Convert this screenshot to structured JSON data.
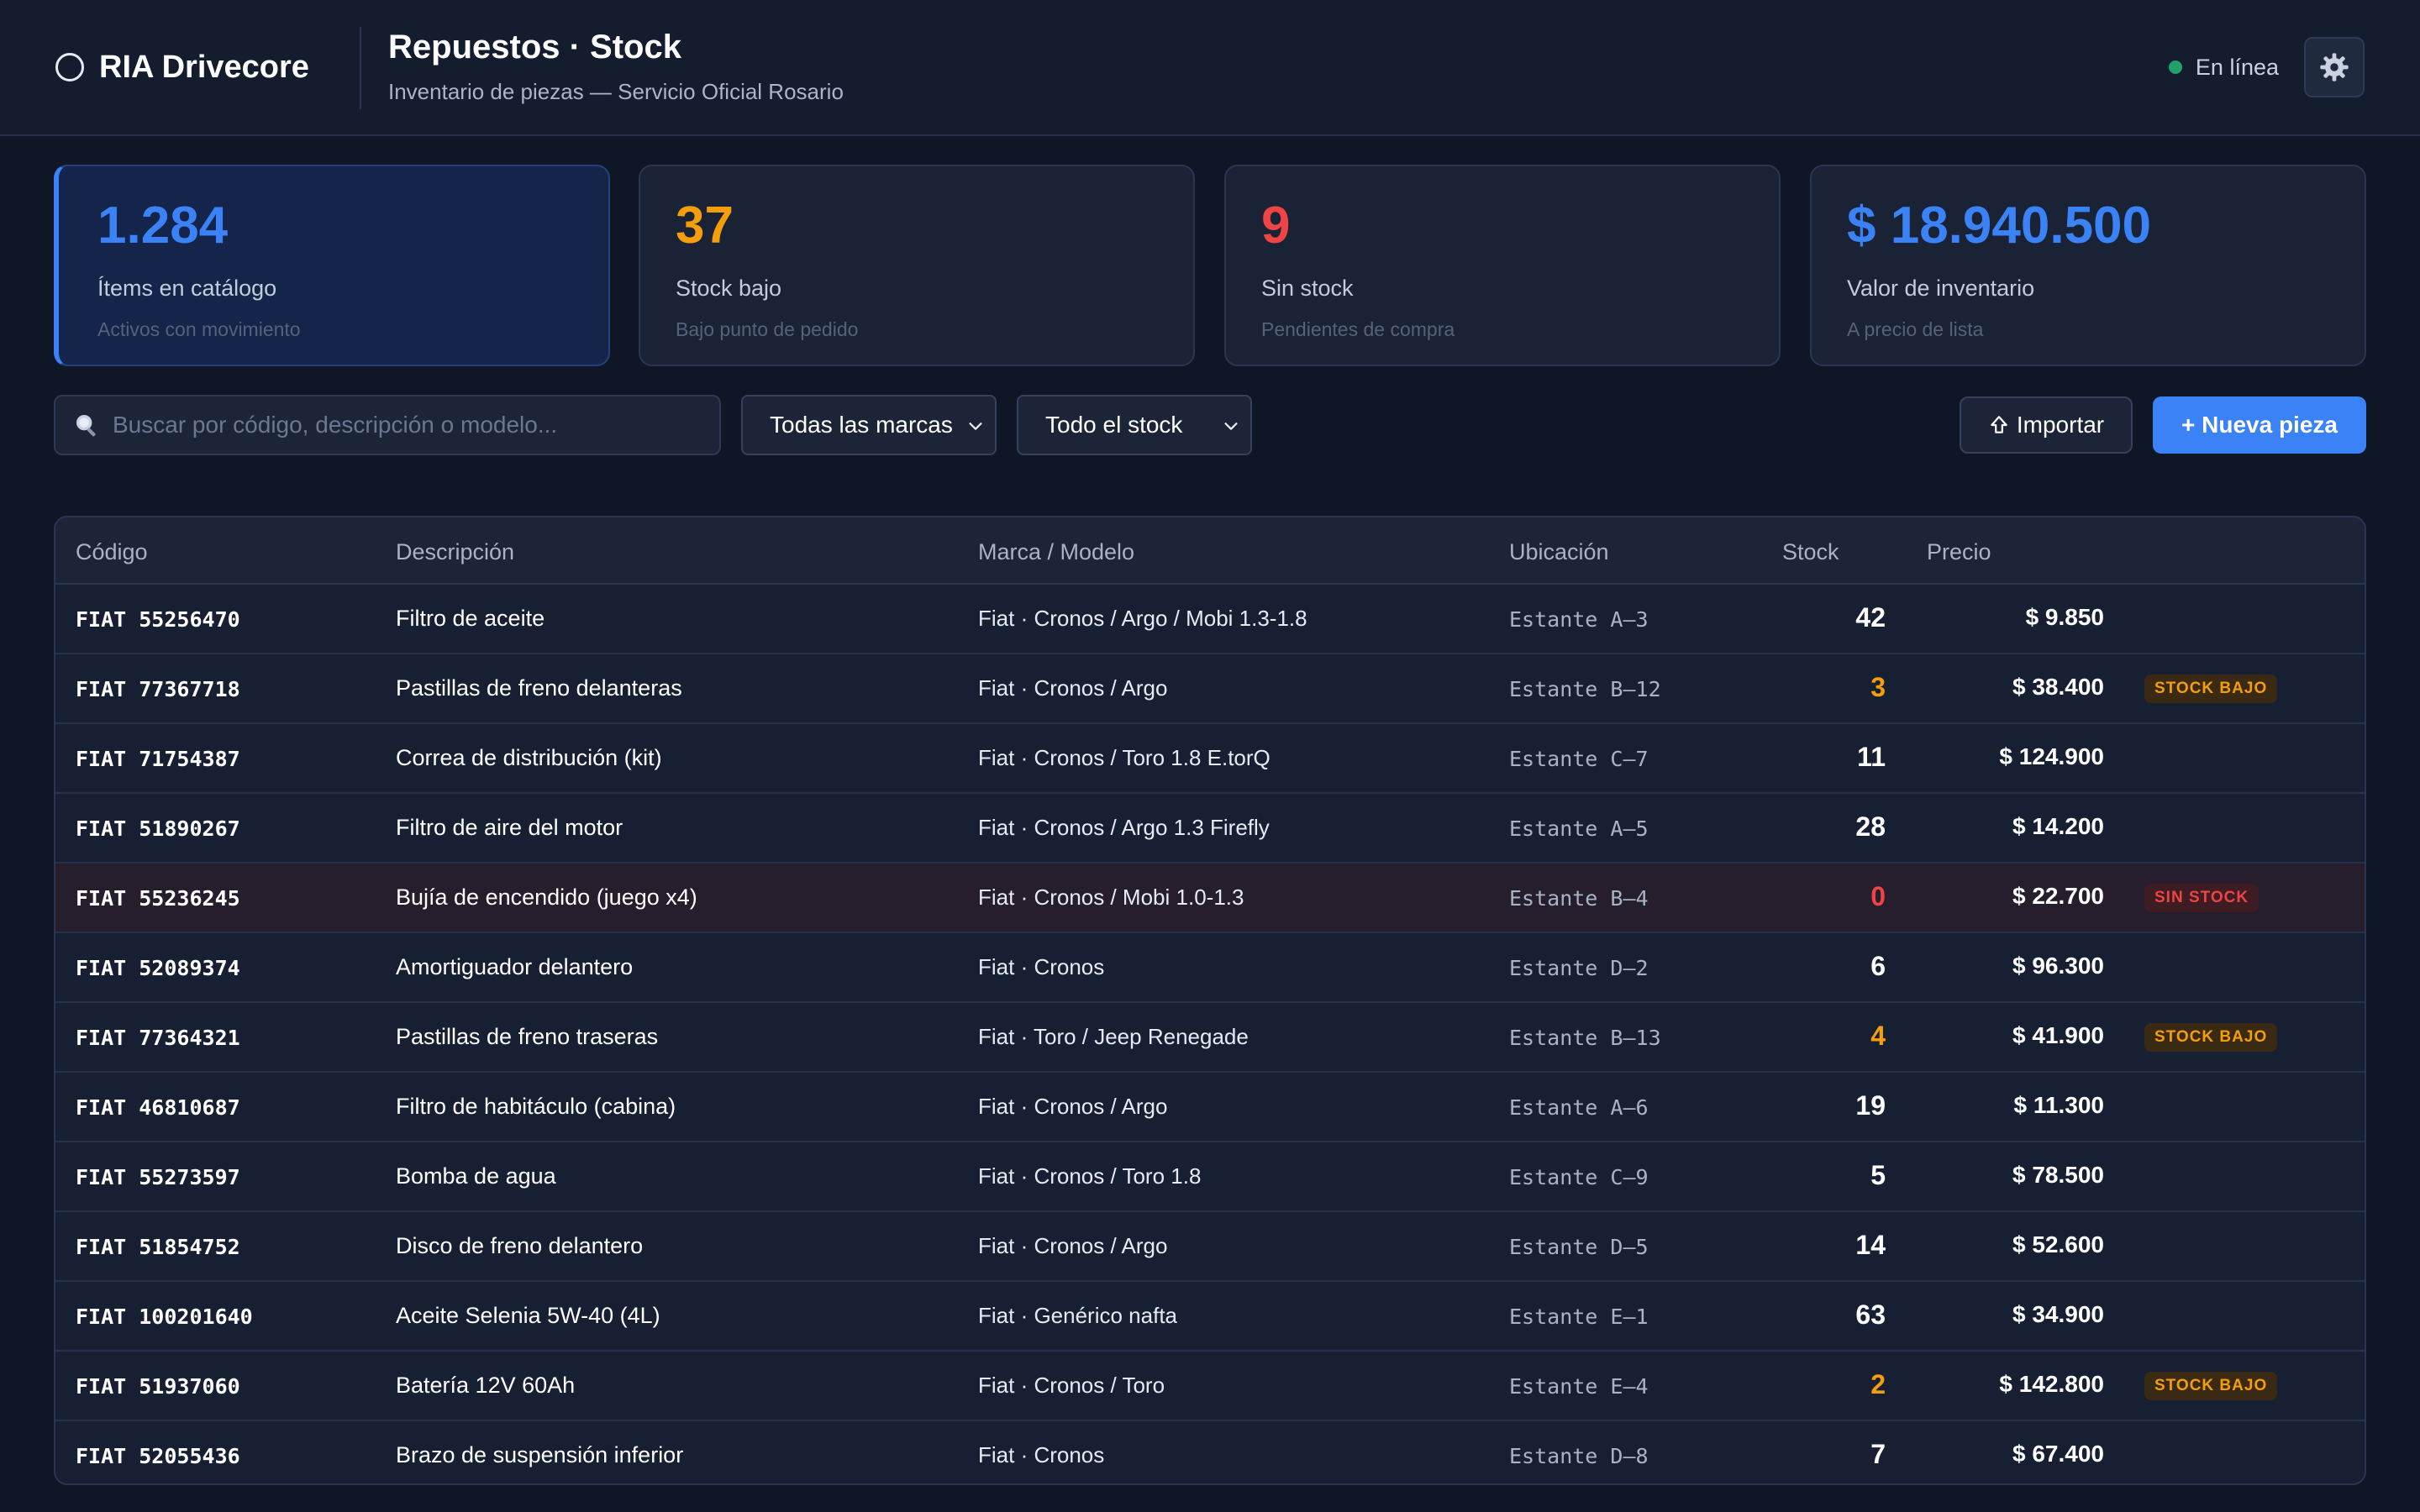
{
  "header": {
    "brand": "RIA Drivecore",
    "title": "Repuestos · Stock",
    "subtitle": "Inventario de piezas — Servicio Oficial Rosario",
    "status": "En línea",
    "status_color": "#22a06b",
    "settings_icon": "gear-icon"
  },
  "stats": [
    {
      "value": "1.284",
      "label": "Ítems en catálogo",
      "sub": "Activos con movimiento",
      "color": "#3b82f6"
    },
    {
      "value": "37",
      "label": "Stock bajo",
      "sub": "Bajo punto de pedido",
      "color": "#f59e0b"
    },
    {
      "value": "9",
      "label": "Sin stock",
      "sub": "Pendientes de compra",
      "color": "#ef4444"
    },
    {
      "value": "$ 18.940.500",
      "label": "Valor de inventario",
      "sub": "A precio de lista",
      "color": "#3b82f6"
    }
  ],
  "toolbar": {
    "search_placeholder": "Buscar por código, descripción o modelo...",
    "brand_filter": "Todas las marcas",
    "stock_filter": "Todo el stock",
    "import_label": "Importar",
    "new_label": "+ Nueva pieza"
  },
  "table": {
    "columns": [
      "Código",
      "Descripción",
      "Marca / Modelo",
      "Ubicación",
      "Stock",
      "Precio"
    ],
    "rows": [
      {
        "code": "FIAT 55256470",
        "desc": "Filtro de aceite",
        "brand": "Fiat · Cronos / Argo / Mobi 1.3-1.8",
        "loc": "Estante A–3",
        "stock": "42",
        "price": "$ 9.850",
        "status": "",
        "badge": ""
      },
      {
        "code": "FIAT 77367718",
        "desc": "Pastillas de freno delanteras",
        "brand": "Fiat · Cronos / Argo",
        "loc": "Estante B–12",
        "stock": "3",
        "price": "$ 38.400",
        "status": "low",
        "badge": "STOCK BAJO"
      },
      {
        "code": "FIAT 71754387",
        "desc": "Correa de distribución (kit)",
        "brand": "Fiat · Cronos / Toro 1.8 E.torQ",
        "loc": "Estante C–7",
        "stock": "11",
        "price": "$ 124.900",
        "status": "",
        "badge": ""
      },
      {
        "code": "FIAT 51890267",
        "desc": "Filtro de aire del motor",
        "brand": "Fiat · Cronos / Argo 1.3 Firefly",
        "loc": "Estante A–5",
        "stock": "28",
        "price": "$ 14.200",
        "status": "",
        "badge": ""
      },
      {
        "code": "FIAT 55236245",
        "desc": "Bujía de encendido (juego x4)",
        "brand": "Fiat · Cronos / Mobi 1.0-1.3",
        "loc": "Estante B–4",
        "stock": "0",
        "price": "$ 22.700",
        "status": "zero",
        "badge": "SIN STOCK"
      },
      {
        "code": "FIAT 52089374",
        "desc": "Amortiguador delantero",
        "brand": "Fiat · Cronos",
        "loc": "Estante D–2",
        "stock": "6",
        "price": "$ 96.300",
        "status": "",
        "badge": ""
      },
      {
        "code": "FIAT 77364321",
        "desc": "Pastillas de freno traseras",
        "brand": "Fiat · Toro / Jeep Renegade",
        "loc": "Estante B–13",
        "stock": "4",
        "price": "$ 41.900",
        "status": "low",
        "badge": "STOCK BAJO"
      },
      {
        "code": "FIAT 46810687",
        "desc": "Filtro de habitáculo (cabina)",
        "brand": "Fiat · Cronos / Argo",
        "loc": "Estante A–6",
        "stock": "19",
        "price": "$ 11.300",
        "status": "",
        "badge": ""
      },
      {
        "code": "FIAT 55273597",
        "desc": "Bomba de agua",
        "brand": "Fiat · Cronos / Toro 1.8",
        "loc": "Estante C–9",
        "stock": "5",
        "price": "$ 78.500",
        "status": "",
        "badge": ""
      },
      {
        "code": "FIAT 51854752",
        "desc": "Disco de freno delantero",
        "brand": "Fiat · Cronos / Argo",
        "loc": "Estante D–5",
        "stock": "14",
        "price": "$ 52.600",
        "status": "",
        "badge": ""
      },
      {
        "code": "FIAT 100201640",
        "desc": "Aceite Selenia 5W-40 (4L)",
        "brand": "Fiat · Genérico nafta",
        "loc": "Estante E–1",
        "stock": "63",
        "price": "$ 34.900",
        "status": "",
        "badge": ""
      },
      {
        "code": "FIAT 51937060",
        "desc": "Batería 12V 60Ah",
        "brand": "Fiat · Cronos / Toro",
        "loc": "Estante E–4",
        "stock": "2",
        "price": "$ 142.800",
        "status": "low",
        "badge": "STOCK BAJO"
      },
      {
        "code": "FIAT 52055436",
        "desc": "Brazo de suspensión inferior",
        "brand": "Fiat · Cronos",
        "loc": "Estante D–8",
        "stock": "7",
        "price": "$ 67.400",
        "status": "",
        "badge": ""
      }
    ]
  }
}
